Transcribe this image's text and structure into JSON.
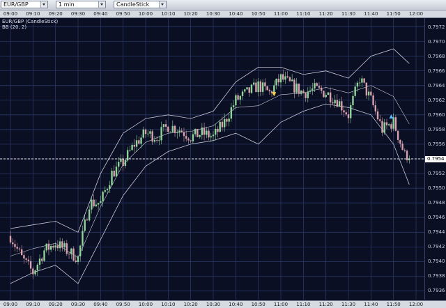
{
  "toolbar": {
    "symbol": "EUR/GBP",
    "interval": "1 min",
    "chart_type": "CandleStick"
  },
  "legend": {
    "instrument": "EUR/GBP (CandleStick)",
    "indicator": "BB (20, 2)"
  },
  "time_labels": [
    "09:00",
    "09:10",
    "09:20",
    "09:30",
    "09:40",
    "09:50",
    "10:00",
    "10:10",
    "10:20",
    "10:30",
    "10:40",
    "10:50",
    "11:00",
    "11:10",
    "11:20",
    "11:30",
    "11:40",
    "11:50",
    "12:00"
  ],
  "price_labels": [
    "0.7972",
    "0.7970",
    "0.7968",
    "0.7966",
    "0.7964",
    "0.7962",
    "0.7960",
    "0.7958",
    "0.7956",
    "0.7954",
    "0.7952",
    "0.7950",
    "0.7948",
    "0.7946",
    "0.7944",
    "0.7942",
    "0.7940",
    "0.7938",
    "0.7936"
  ],
  "current_price": "0.7954",
  "colors": {
    "background": "#0b0f24",
    "grid": "#2e3c6b",
    "bull": "#8fd29a",
    "bear": "#d7a1ae",
    "bands": "#c8ccd8",
    "price_line": "#e8e8e8",
    "up_arrow": "#5fb8ff",
    "down_arrow": "#ffd24a"
  },
  "chart_data": {
    "type": "candlestick",
    "symbol": "EUR/GBP",
    "interval": "1 min",
    "indicator": "BB (20, 2)",
    "ylim": [
      0.7935,
      0.7973
    ],
    "x_range": [
      "09:00",
      "12:00"
    ],
    "grid": true,
    "current_price": 0.7954,
    "close_path": [
      [
        "09:00",
        0.79435
      ],
      [
        "09:05",
        0.79405
      ],
      [
        "09:10",
        0.79385
      ],
      [
        "09:15",
        0.79415
      ],
      [
        "09:20",
        0.79425
      ],
      [
        "09:25",
        0.79415
      ],
      [
        "09:30",
        0.79405
      ],
      [
        "09:35",
        0.7948
      ],
      [
        "09:40",
        0.7948
      ],
      [
        "09:45",
        0.7952
      ],
      [
        "09:50",
        0.79535
      ],
      [
        "09:55",
        0.7956
      ],
      [
        "10:00",
        0.79575
      ],
      [
        "10:05",
        0.7957
      ],
      [
        "10:10",
        0.79585
      ],
      [
        "10:15",
        0.7958
      ],
      [
        "10:20",
        0.7957
      ],
      [
        "10:25",
        0.79575
      ],
      [
        "10:30",
        0.7957
      ],
      [
        "10:35",
        0.7959
      ],
      [
        "10:40",
        0.7962
      ],
      [
        "10:45",
        0.7963
      ],
      [
        "10:50",
        0.7964
      ],
      [
        "10:55",
        0.7963
      ],
      [
        "11:00",
        0.7965
      ],
      [
        "11:05",
        0.7964
      ],
      [
        "11:10",
        0.7963
      ],
      [
        "11:15",
        0.79635
      ],
      [
        "11:20",
        0.7963
      ],
      [
        "11:25",
        0.7962
      ],
      [
        "11:30",
        0.796
      ],
      [
        "11:35",
        0.7965
      ],
      [
        "11:40",
        0.7962
      ],
      [
        "11:45",
        0.7958
      ],
      [
        "11:50",
        0.7959
      ],
      [
        "11:55",
        0.79545
      ]
    ],
    "upper_band": [
      [
        "09:00",
        0.79445
      ],
      [
        "09:10",
        0.7945
      ],
      [
        "09:20",
        0.79455
      ],
      [
        "09:30",
        0.7944
      ],
      [
        "09:40",
        0.7952
      ],
      [
        "09:50",
        0.79575
      ],
      [
        "10:00",
        0.79595
      ],
      [
        "10:10",
        0.796
      ],
      [
        "10:20",
        0.79595
      ],
      [
        "10:30",
        0.79605
      ],
      [
        "10:40",
        0.79645
      ],
      [
        "10:50",
        0.79665
      ],
      [
        "11:00",
        0.79665
      ],
      [
        "11:10",
        0.79655
      ],
      [
        "11:20",
        0.7966
      ],
      [
        "11:30",
        0.7965
      ],
      [
        "11:40",
        0.7968
      ],
      [
        "11:50",
        0.7969
      ],
      [
        "11:57",
        0.7967
      ]
    ],
    "lower_band": [
      [
        "09:00",
        0.7937
      ],
      [
        "09:10",
        0.79385
      ],
      [
        "09:20",
        0.79395
      ],
      [
        "09:30",
        0.7937
      ],
      [
        "09:40",
        0.7943
      ],
      [
        "09:50",
        0.7949
      ],
      [
        "10:00",
        0.7953
      ],
      [
        "10:10",
        0.7955
      ],
      [
        "10:20",
        0.7956
      ],
      [
        "10:30",
        0.79565
      ],
      [
        "10:40",
        0.79575
      ],
      [
        "10:50",
        0.7956
      ],
      [
        "11:00",
        0.7959
      ],
      [
        "11:10",
        0.79605
      ],
      [
        "11:20",
        0.79615
      ],
      [
        "11:30",
        0.7961
      ],
      [
        "11:40",
        0.796
      ],
      [
        "11:50",
        0.7956
      ],
      [
        "11:57",
        0.79505
      ]
    ],
    "markers": [
      {
        "type": "sell-arrow",
        "time": "10:57",
        "price": 0.7963
      },
      {
        "type": "buy-arrow",
        "time": "11:49",
        "price": 0.79595
      }
    ]
  }
}
